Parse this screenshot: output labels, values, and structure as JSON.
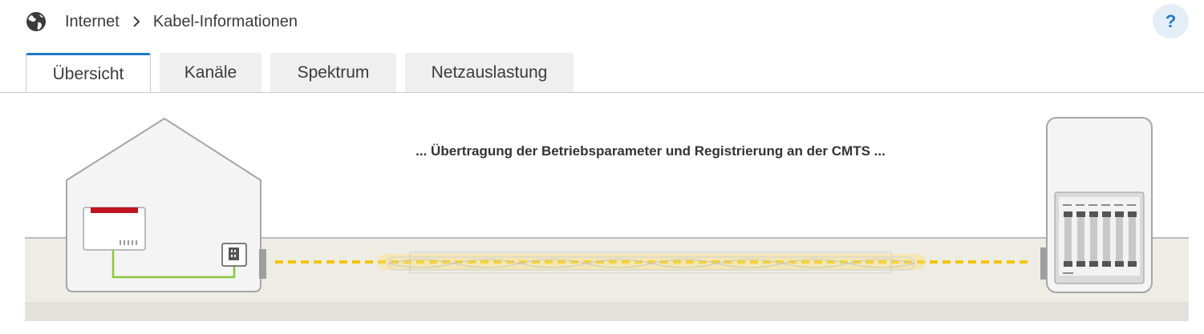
{
  "breadcrumb": {
    "icon": "globe-icon",
    "items": [
      "Internet",
      "Kabel-Informationen"
    ]
  },
  "help": {
    "label": "?"
  },
  "tabs": [
    {
      "label": "Übersicht",
      "active": true
    },
    {
      "label": "Kanäle",
      "active": false
    },
    {
      "label": "Spektrum",
      "active": false
    },
    {
      "label": "Netzauslastung",
      "active": false
    }
  ],
  "status": {
    "message": "... Übertragung der Betriebsparameter und Registrierung an der CMTS ..."
  },
  "colors": {
    "accent": "#1f78c8",
    "router_red": "#c0141f",
    "cable_green": "#8dc63f",
    "signal_yellow": "#f2c500",
    "ground": "#efece6"
  }
}
